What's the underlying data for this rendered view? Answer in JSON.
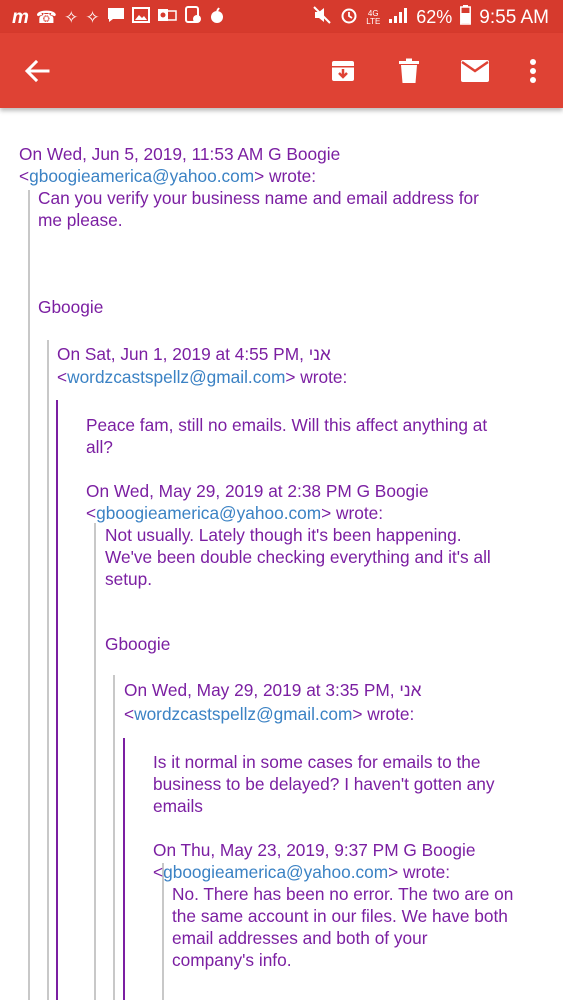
{
  "status_bar": {
    "left_icons": [
      "m",
      "incoming-call-icon",
      "app-icon",
      "app-icon",
      "message-icon",
      "image-icon",
      "outlook-icon",
      "app-icon",
      "bomb-icon"
    ],
    "battery": "62%",
    "time": "9:55 AM",
    "signal_label": "4G LTE"
  },
  "toolbar": {
    "back_icon": "arrow-left-icon",
    "archive_icon": "archive-icon",
    "delete_icon": "trash-icon",
    "mark_unread_icon": "mail-icon",
    "more_icon": "more-vert-icon"
  },
  "thread": {
    "level0": {
      "header_line1": "On Wed, Jun 5, 2019, 11:53 AM G Boogie",
      "header_prefix": "<",
      "header_email": "gboogieamerica@yahoo.com",
      "header_suffix": "> wrote:",
      "body_line1": "Can you verify your business name and email address for",
      "body_line2": "me please.",
      "signature": "Gboogie"
    },
    "level1": {
      "header_line1": "On Sat, Jun 1, 2019 at 4:55 PM, אני",
      "header_prefix": "<",
      "header_email": "wordzcastspellz@gmail.com",
      "header_suffix": "> wrote:"
    },
    "level2": {
      "body_line1": "Peace fam, still no emails. Will this affect anything at",
      "body_line2": "all?",
      "header_line1": "On Wed, May 29, 2019 at 2:38 PM G Boogie",
      "header_prefix": "<",
      "header_email": "gboogieamerica@yahoo.com",
      "header_suffix": "> wrote:"
    },
    "level3": {
      "body_line1": "Not usually. Lately though it's been happening.",
      "body_line2": "We've been double checking everything and it's all",
      "body_line3": "setup.",
      "signature": "Gboogie"
    },
    "level4": {
      "header_line1": "On Wed, May 29, 2019 at 3:35 PM, אני",
      "header_prefix": "<",
      "header_email": "wordzcastspellz@gmail.com",
      "header_suffix": "> wrote:"
    },
    "level5": {
      "body_line1": "Is it normal in some cases for emails to the",
      "body_line2": "business to be delayed? I haven't gotten any",
      "body_line3": "emails",
      "header_line1": "On Thu, May 23, 2019, 9:37 PM G Boogie",
      "header_prefix": "<",
      "header_email": "gboogieamerica@yahoo.com",
      "header_suffix": "> wrote:"
    },
    "level6": {
      "body_line1": "No. There has been no error. The two are on",
      "body_line2": "the same account in our files. We have both",
      "body_line3": "email addresses and both of your",
      "body_line4": "company's info."
    }
  },
  "colors": {
    "toolbar": "#df4234",
    "status_bar": "#d63a2d",
    "text": "#7b1fa2",
    "link": "#3b82c4",
    "quote_grey": "#c8c8c8",
    "quote_purple": "#7b1fa2"
  }
}
